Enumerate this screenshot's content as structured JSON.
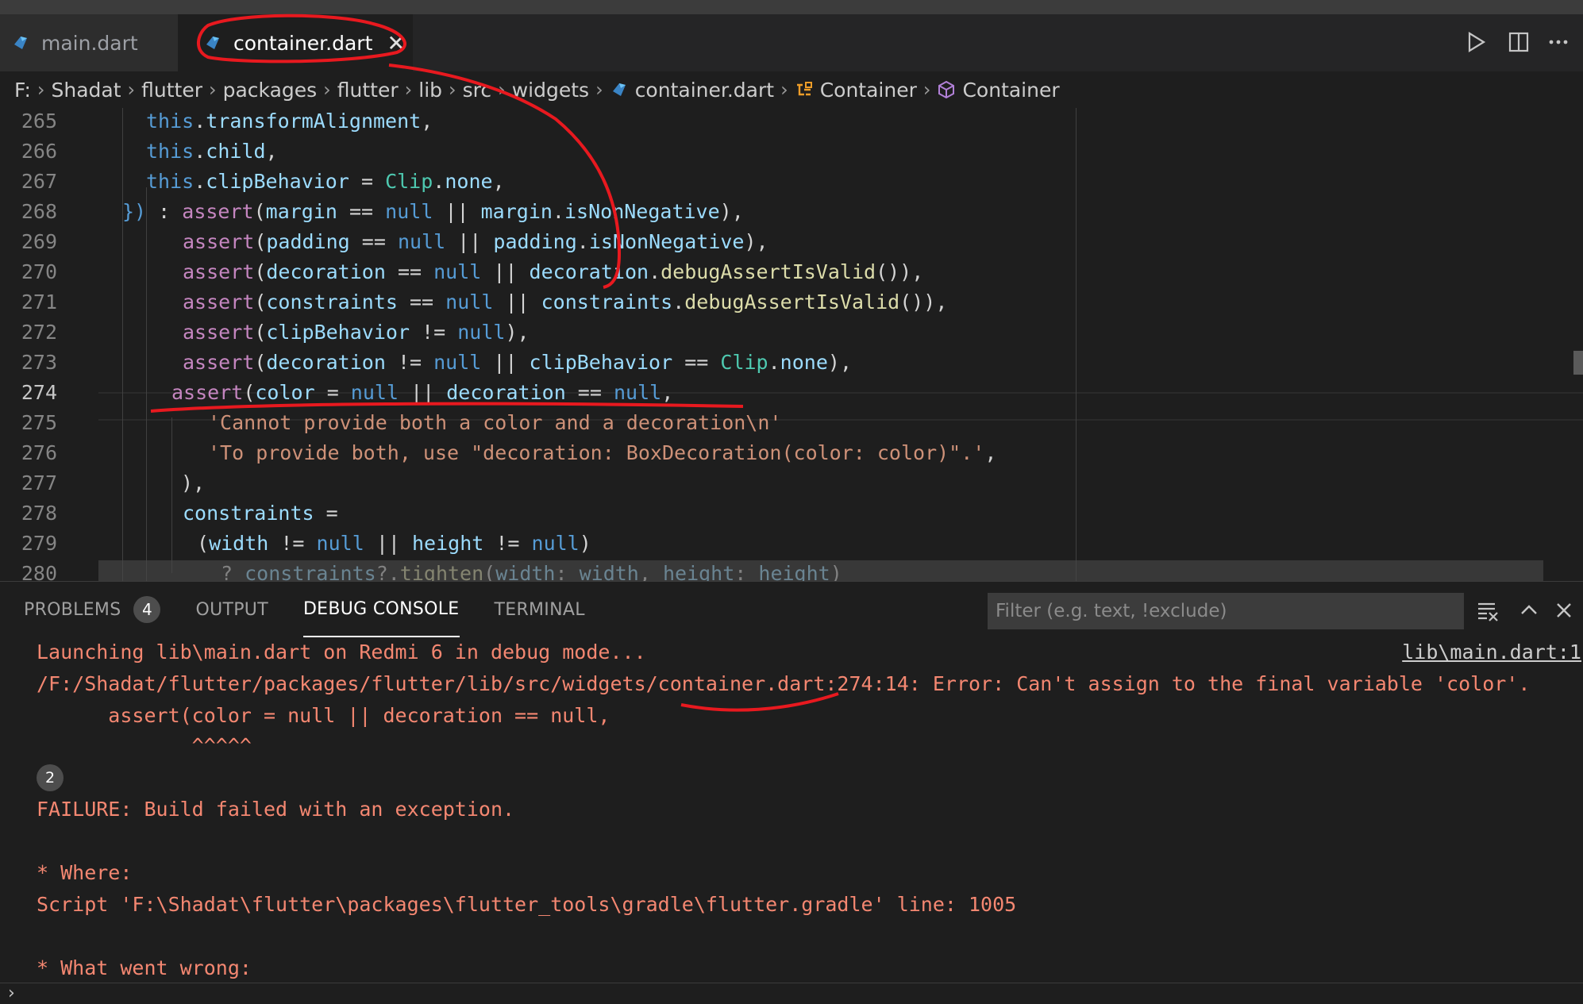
{
  "tabs": {
    "main": "main.dart",
    "container": "container.dart",
    "close_glyph": "✕"
  },
  "breadcrumb": [
    "F:",
    "Shadat",
    "flutter",
    "packages",
    "flutter",
    "lib",
    "src",
    "widgets",
    "container.dart",
    "Container",
    "Container"
  ],
  "editor": {
    "lines": [
      {
        "n": "265",
        "html": "<span class=\"kw\">this</span>.<span class=\"var\">transformAlignment</span>,"
      },
      {
        "n": "266",
        "html": "<span class=\"kw\">this</span>.<span class=\"var\">child</span>,"
      },
      {
        "n": "267",
        "html": "<span class=\"kw\">this</span>.<span class=\"var\">clipBehavior</span> = <span class=\"ty\">Clip</span>.<span class=\"var\">none</span>,"
      },
      {
        "n": "268",
        "html": "<span class=\"kw\">})</span> : <span class=\"pur\">assert</span>(<span class=\"var\">margin</span> == <span class=\"kw\">null</span> || <span class=\"var\">margin</span>.<span class=\"var\">isNonNegative</span>),"
      },
      {
        "n": "269",
        "html": "<span class=\"pur\">assert</span>(<span class=\"var\">padding</span> == <span class=\"kw\">null</span> || <span class=\"var\">padding</span>.<span class=\"var\">isNonNegative</span>),"
      },
      {
        "n": "270",
        "html": "<span class=\"pur\">assert</span>(<span class=\"var\">decoration</span> == <span class=\"kw\">null</span> || <span class=\"var\">decoration</span>.<span class=\"fn\">debugAssertIsValid</span>()),"
      },
      {
        "n": "271",
        "html": "<span class=\"pur\">assert</span>(<span class=\"var\">constraints</span> == <span class=\"kw\">null</span> || <span class=\"var\">constraints</span>.<span class=\"fn\">debugAssertIsValid</span>()),"
      },
      {
        "n": "272",
        "html": "<span class=\"pur\">assert</span>(<span class=\"var\">clipBehavior</span> != <span class=\"kw\">null</span>),"
      },
      {
        "n": "273",
        "html": "<span class=\"pur\">assert</span>(<span class=\"var\">decoration</span> != <span class=\"kw\">null</span> || <span class=\"var\">clipBehavior</span> == <span class=\"ty\">Clip</span>.<span class=\"var\">none</span>),"
      },
      {
        "n": "274",
        "html": "<span class=\"pur\">assert</span>(<span class=\"var\">color</span> = <span class=\"kw\">null</span> || <span class=\"var\">decoration</span> == <span class=\"kw\">null</span>,"
      },
      {
        "n": "275",
        "html": "<span class=\"str\">'Cannot provide both a color and a decoration\\n'</span>"
      },
      {
        "n": "276",
        "html": "<span class=\"str\">'To provide both, use \"decoration: BoxDecoration(color: color)\".'</span>,"
      },
      {
        "n": "277",
        "html": "),"
      },
      {
        "n": "278",
        "html": "<span class=\"var\">constraints</span> ="
      },
      {
        "n": "279",
        "html": "(<span class=\"var\">width</span> != <span class=\"kw\">null</span> || <span class=\"var\">height</span> != <span class=\"kw\">null</span>)"
      },
      {
        "n": "280",
        "html": "? <span class=\"var\">constraints</span>?.<span class=\"fn\">tighten</span>(<span class=\"var\">width</span>: <span class=\"var\">width</span>, <span class=\"var\">height</span>: <span class=\"var\">height</span>)"
      }
    ],
    "current_line": "274"
  },
  "panel": {
    "tabs": [
      "PROBLEMS",
      "OUTPUT",
      "DEBUG CONSOLE",
      "TERMINAL"
    ],
    "problems_count": "4",
    "filter_placeholder": "Filter (e.g. text, !exclude)",
    "source_link": "lib\\main.dart:1",
    "console_lines": [
      "Launching lib\\main.dart on Redmi 6 in debug mode...",
      "/F:/Shadat/flutter/packages/flutter/lib/src/widgets/container.dart:274:14: Error: Can't assign to the final variable 'color'.",
      "      assert(color = null || decoration == null,",
      "             ^^^^^",
      "FAILURE: Build failed with an exception.",
      "* Where:",
      "Script 'F:\\Shadat\\flutter\\packages\\flutter_tools\\gradle\\flutter.gradle' line: 1005",
      "* What went wrong:"
    ],
    "repeat_count": "2",
    "prompt": "›"
  },
  "colors": {
    "accent_annotation": "#e8191f",
    "error_text": "#f48771",
    "editor_bg": "#1e1e1e"
  },
  "icons": [
    "dart-file-icon",
    "close-icon",
    "run-icon",
    "split-editor-icon",
    "more-icon",
    "class-icon",
    "cube-icon",
    "clear-console-icon",
    "maximize-panel-icon",
    "close-panel-icon"
  ]
}
